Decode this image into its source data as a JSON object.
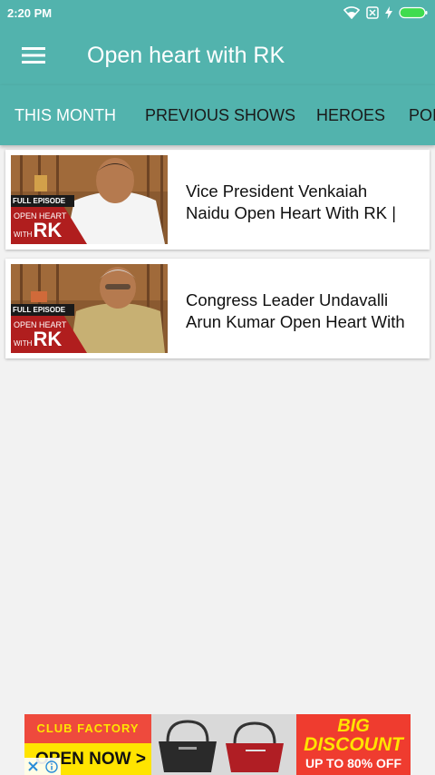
{
  "status_bar": {
    "time": "2:20 PM",
    "icons": [
      "wifi-icon",
      "sim-blocked-icon",
      "charging-icon",
      "battery-icon"
    ]
  },
  "app_bar": {
    "menu_icon": "hamburger-menu-icon",
    "title": "Open heart with RK"
  },
  "tabs": [
    {
      "label": "THIS MONTH",
      "active": true
    },
    {
      "label": "PREVIOUS SHOWS",
      "active": false
    },
    {
      "label": "HEROES",
      "active": false
    },
    {
      "label": "POI",
      "active": false
    }
  ],
  "videos": [
    {
      "title_line1": "Vice President Venkaiah",
      "title_line2": "Naidu Open Heart With RK |",
      "thumb": {
        "badge": "FULL EPISODE",
        "line1": "OPEN HEART",
        "line2": "WITH",
        "line3": "RK"
      }
    },
    {
      "title_line1": "Congress Leader Undavalli",
      "title_line2": "Arun Kumar Open Heart With",
      "thumb": {
        "badge": "FULL EPISODE",
        "line1": "OPEN HEART",
        "line2": "WITH",
        "line3": "RK"
      }
    }
  ],
  "ad": {
    "brand": "CLUB FACTORY",
    "cta": "OPEN NOW >",
    "headline_big": "BIG",
    "headline_discount": "DISCOUNT",
    "offer": "UP TO 80% OFF",
    "close_icon": "close-icon",
    "info_icon": "info-icon"
  },
  "colors": {
    "primary": "#52b3ad",
    "background": "#f2f2f2",
    "ad_red": "#ee4a3d",
    "ad_yellow": "#ffe400"
  }
}
